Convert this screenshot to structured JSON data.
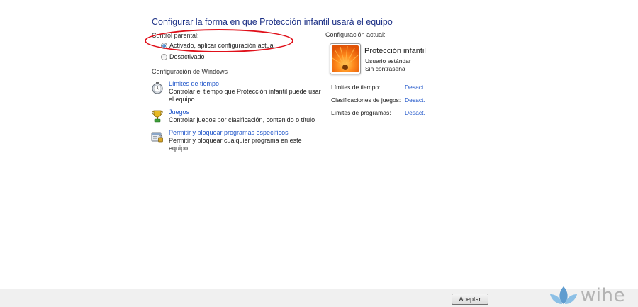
{
  "title": "Configurar la forma en que Protección infantil usará el equipo",
  "parental": {
    "label": "Control parental:",
    "options": [
      {
        "label": "Activado, aplicar configuración actual",
        "selected": true
      },
      {
        "label": "Desactivado",
        "selected": false
      }
    ]
  },
  "windows_settings": {
    "label": "Configuración de Windows",
    "items": [
      {
        "icon": "stopwatch-icon",
        "link": "Límites de tiempo",
        "desc": "Controlar el tiempo que Protección infantil puede usar el equipo"
      },
      {
        "icon": "trophy-icon",
        "link": "Juegos",
        "desc": "Controlar juegos por clasificación, contenido o título"
      },
      {
        "icon": "program-lock-icon",
        "link": "Permitir y bloquear programas específicos",
        "desc": "Permitir y bloquear cualquier programa en este equipo"
      }
    ]
  },
  "current": {
    "label": "Configuración actual:",
    "user_name": "Protección infantil",
    "account_type": "Usuario estándar",
    "password": "Sin contraseña",
    "stats": [
      {
        "label": "Límites de tiempo:",
        "value": "Desact."
      },
      {
        "label": "Clasificaciones de juegos:",
        "value": "Desact."
      },
      {
        "label": "Límites de programas:",
        "value": "Desact."
      }
    ]
  },
  "footer": {
    "accept_label": "Aceptar"
  },
  "watermark": {
    "text": "wihe"
  },
  "colors": {
    "link": "#1f55c9",
    "title": "#1e3287",
    "highlight": "#e0101a"
  }
}
